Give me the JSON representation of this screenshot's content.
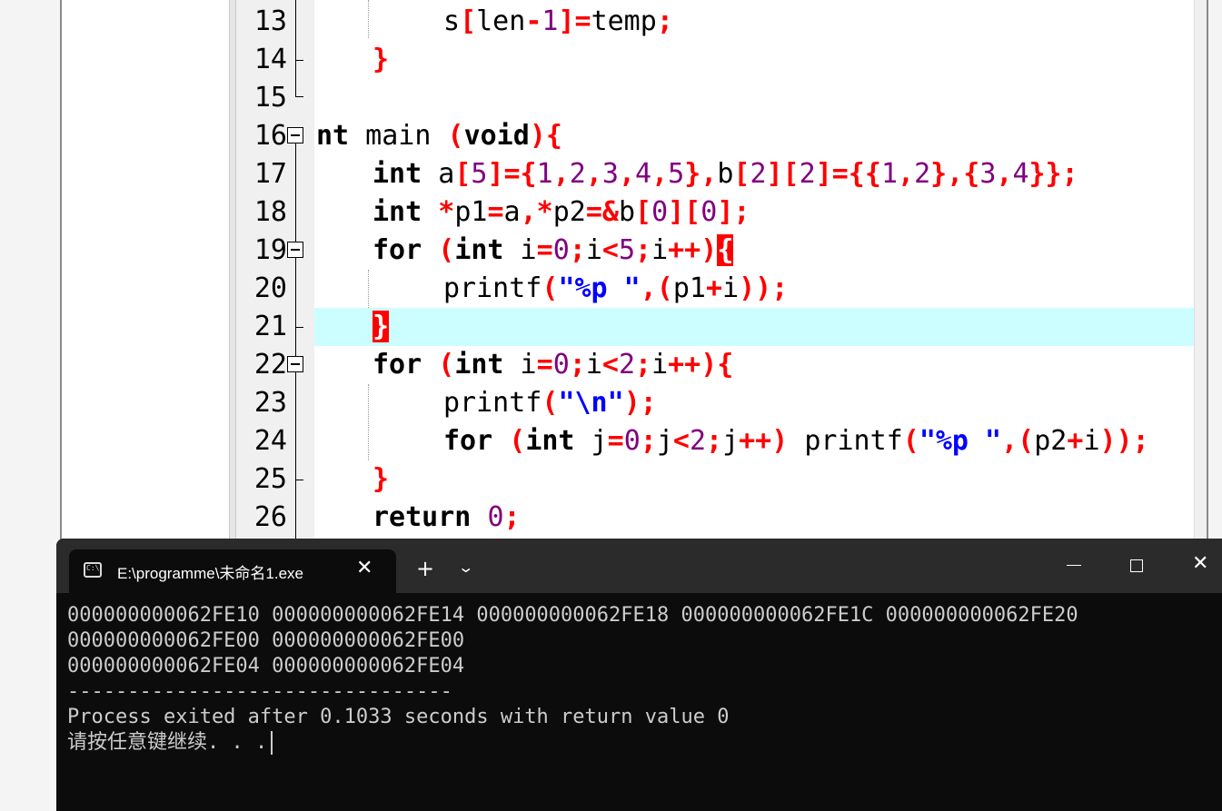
{
  "editor": {
    "lines": [
      {
        "num": "13",
        "tokens": [
          {
            "t": "s",
            "c": ""
          },
          {
            "t": "[",
            "c": "sy"
          },
          {
            "t": "len",
            "c": ""
          },
          {
            "t": "-",
            "c": "sy"
          },
          {
            "t": "1",
            "c": "nu"
          },
          {
            "t": "]=",
            "c": "sy"
          },
          {
            "t": "temp",
            "c": ""
          },
          {
            "t": ";",
            "c": "sy"
          }
        ]
      },
      {
        "num": "14",
        "tokens": [
          {
            "t": "}",
            "c": "sy"
          }
        ]
      },
      {
        "num": "15",
        "tokens": []
      },
      {
        "num": "16",
        "tokens": [
          {
            "t": "nt",
            "c": "kw"
          },
          {
            "t": " main ",
            "c": ""
          },
          {
            "t": "(",
            "c": "sy"
          },
          {
            "t": "void",
            "c": "kw"
          },
          {
            "t": "){",
            "c": "sy"
          }
        ]
      },
      {
        "num": "17",
        "tokens": [
          {
            "t": "int",
            "c": "kw"
          },
          {
            "t": " a",
            "c": ""
          },
          {
            "t": "[",
            "c": "sy"
          },
          {
            "t": "5",
            "c": "nu"
          },
          {
            "t": "]={",
            "c": "sy"
          },
          {
            "t": "1",
            "c": "nu"
          },
          {
            "t": ",",
            "c": "sy"
          },
          {
            "t": "2",
            "c": "nu"
          },
          {
            "t": ",",
            "c": "sy"
          },
          {
            "t": "3",
            "c": "nu"
          },
          {
            "t": ",",
            "c": "sy"
          },
          {
            "t": "4",
            "c": "nu"
          },
          {
            "t": ",",
            "c": "sy"
          },
          {
            "t": "5",
            "c": "nu"
          },
          {
            "t": "},",
            "c": "sy"
          },
          {
            "t": "b",
            "c": ""
          },
          {
            "t": "[",
            "c": "sy"
          },
          {
            "t": "2",
            "c": "nu"
          },
          {
            "t": "][",
            "c": "sy"
          },
          {
            "t": "2",
            "c": "nu"
          },
          {
            "t": "]={{",
            "c": "sy"
          },
          {
            "t": "1",
            "c": "nu"
          },
          {
            "t": ",",
            "c": "sy"
          },
          {
            "t": "2",
            "c": "nu"
          },
          {
            "t": "},{",
            "c": "sy"
          },
          {
            "t": "3",
            "c": "nu"
          },
          {
            "t": ",",
            "c": "sy"
          },
          {
            "t": "4",
            "c": "nu"
          },
          {
            "t": "}};",
            "c": "sy"
          }
        ]
      },
      {
        "num": "18",
        "tokens": [
          {
            "t": "int",
            "c": "kw"
          },
          {
            "t": " ",
            "c": ""
          },
          {
            "t": "*",
            "c": "sy"
          },
          {
            "t": "p1",
            "c": ""
          },
          {
            "t": "=",
            "c": "sy"
          },
          {
            "t": "a",
            "c": ""
          },
          {
            "t": ",*",
            "c": "sy"
          },
          {
            "t": "p2",
            "c": ""
          },
          {
            "t": "=&",
            "c": "sy"
          },
          {
            "t": "b",
            "c": ""
          },
          {
            "t": "[",
            "c": "sy"
          },
          {
            "t": "0",
            "c": "nu"
          },
          {
            "t": "][",
            "c": "sy"
          },
          {
            "t": "0",
            "c": "nu"
          },
          {
            "t": "];",
            "c": "sy"
          }
        ]
      },
      {
        "num": "19",
        "tokens": [
          {
            "t": "for",
            "c": "kw"
          },
          {
            "t": " ",
            "c": ""
          },
          {
            "t": "(",
            "c": "sy"
          },
          {
            "t": "int",
            "c": "kw"
          },
          {
            "t": " i",
            "c": ""
          },
          {
            "t": "=",
            "c": "sy"
          },
          {
            "t": "0",
            "c": "nu"
          },
          {
            "t": ";",
            "c": "sy"
          },
          {
            "t": "i",
            "c": ""
          },
          {
            "t": "<",
            "c": "sy"
          },
          {
            "t": "5",
            "c": "nu"
          },
          {
            "t": ";",
            "c": "sy"
          },
          {
            "t": "i",
            "c": ""
          },
          {
            "t": "++)",
            "c": "sy"
          },
          {
            "t": "{",
            "c": "bm"
          }
        ]
      },
      {
        "num": "20",
        "tokens": [
          {
            "t": "printf",
            "c": ""
          },
          {
            "t": "(",
            "c": "sy"
          },
          {
            "t": "\"%p \"",
            "c": "st"
          },
          {
            "t": ",(",
            "c": "sy"
          },
          {
            "t": "p1",
            "c": ""
          },
          {
            "t": "+",
            "c": "sy"
          },
          {
            "t": "i",
            "c": ""
          },
          {
            "t": "));",
            "c": "sy"
          }
        ]
      },
      {
        "num": "21",
        "tokens": [
          {
            "t": "}",
            "c": "bm"
          }
        ]
      },
      {
        "num": "22",
        "tokens": [
          {
            "t": "for",
            "c": "kw"
          },
          {
            "t": " ",
            "c": ""
          },
          {
            "t": "(",
            "c": "sy"
          },
          {
            "t": "int",
            "c": "kw"
          },
          {
            "t": " i",
            "c": ""
          },
          {
            "t": "=",
            "c": "sy"
          },
          {
            "t": "0",
            "c": "nu"
          },
          {
            "t": ";",
            "c": "sy"
          },
          {
            "t": "i",
            "c": ""
          },
          {
            "t": "<",
            "c": "sy"
          },
          {
            "t": "2",
            "c": "nu"
          },
          {
            "t": ";",
            "c": "sy"
          },
          {
            "t": "i",
            "c": ""
          },
          {
            "t": "++){",
            "c": "sy"
          }
        ]
      },
      {
        "num": "23",
        "tokens": [
          {
            "t": "printf",
            "c": ""
          },
          {
            "t": "(",
            "c": "sy"
          },
          {
            "t": "\"\\n\"",
            "c": "st"
          },
          {
            "t": ");",
            "c": "sy"
          }
        ]
      },
      {
        "num": "24",
        "tokens": [
          {
            "t": "for",
            "c": "kw"
          },
          {
            "t": " ",
            "c": ""
          },
          {
            "t": "(",
            "c": "sy"
          },
          {
            "t": "int",
            "c": "kw"
          },
          {
            "t": " j",
            "c": ""
          },
          {
            "t": "=",
            "c": "sy"
          },
          {
            "t": "0",
            "c": "nu"
          },
          {
            "t": ";",
            "c": "sy"
          },
          {
            "t": "j",
            "c": ""
          },
          {
            "t": "<",
            "c": "sy"
          },
          {
            "t": "2",
            "c": "nu"
          },
          {
            "t": ";",
            "c": "sy"
          },
          {
            "t": "j",
            "c": ""
          },
          {
            "t": "++)",
            "c": "sy"
          },
          {
            "t": " printf",
            "c": ""
          },
          {
            "t": "(",
            "c": "sy"
          },
          {
            "t": "\"%p \"",
            "c": "st"
          },
          {
            "t": ",(",
            "c": "sy"
          },
          {
            "t": "p2",
            "c": ""
          },
          {
            "t": "+",
            "c": "sy"
          },
          {
            "t": "i",
            "c": ""
          },
          {
            "t": "));",
            "c": "sy"
          }
        ]
      },
      {
        "num": "25",
        "tokens": [
          {
            "t": "}",
            "c": "sy"
          }
        ]
      },
      {
        "num": "26",
        "tokens": [
          {
            "t": "return",
            "c": "kw"
          },
          {
            "t": " ",
            "c": ""
          },
          {
            "t": "0",
            "c": "nu"
          },
          {
            "t": ";",
            "c": "sy"
          }
        ]
      }
    ],
    "current_line": "21"
  },
  "terminal": {
    "tab_title": "E:\\programme\\未命名1.exe",
    "tab_icon": "terminal-icon",
    "tab_icon_glyph": "C:\\",
    "close_tab_glyph": "✕",
    "new_tab_glyph": "+",
    "dropdown_glyph": "⌄",
    "close_window_glyph": "✕",
    "output": [
      "000000000062FE10 000000000062FE14 000000000062FE18 000000000062FE1C 000000000062FE20",
      "000000000062FE00 000000000062FE00",
      "000000000062FE04 000000000062FE04",
      "--------------------------------",
      "Process exited after 0.1033 seconds with return value 0",
      "请按任意键继续. . ."
    ]
  }
}
